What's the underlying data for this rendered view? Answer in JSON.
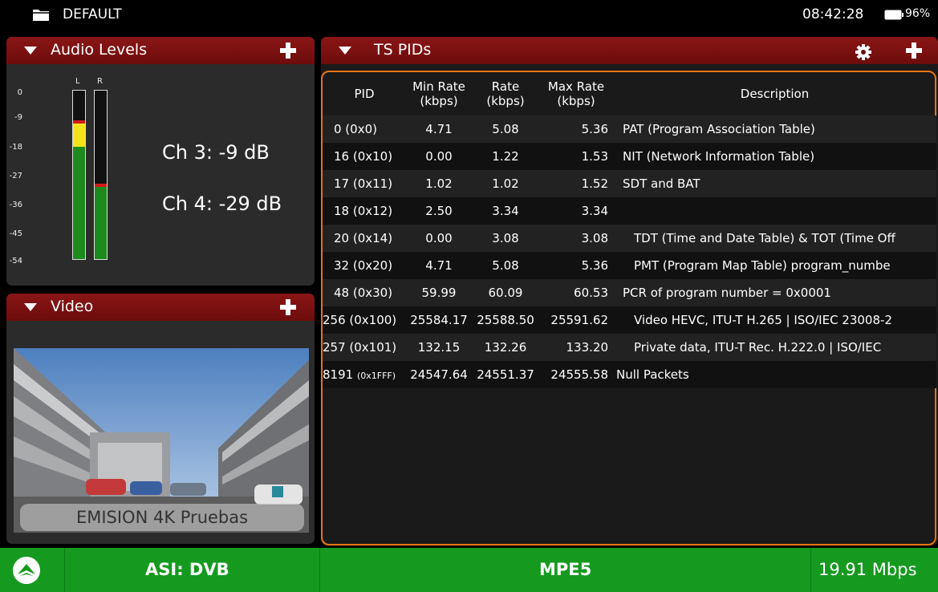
{
  "status_bar": {
    "profile": "DEFAULT",
    "time": "08:42:28",
    "battery": "96%"
  },
  "audio_panel": {
    "title": "Audio Levels",
    "scale": [
      "0",
      "-9",
      "-18",
      "-27",
      "-36",
      "-45",
      "-54"
    ],
    "left_label": "L",
    "right_label": "R",
    "channels": [
      {
        "label": "Ch 3:  -9 dB"
      },
      {
        "label": "Ch 4:  -29 dB"
      }
    ],
    "levels_db": {
      "L": -9,
      "R": -29
    }
  },
  "video_panel": {
    "title": "Video",
    "caption": "EMISION 4K Pruebas"
  },
  "ts_panel": {
    "title": "TS PIDs",
    "columns": {
      "pid": "PID",
      "min_rate_1": "Min Rate",
      "min_rate_2": "(kbps)",
      "rate_1": "Rate",
      "rate_2": "(kbps)",
      "max_rate_1": "Max Rate",
      "max_rate_2": "(kbps)",
      "description": "Description"
    },
    "rows": [
      {
        "pid": "0 (0x0)",
        "min": "4.71",
        "rate": "5.08",
        "max": "5.36",
        "desc": "PAT (Program Association Table)"
      },
      {
        "pid": "16 (0x10)",
        "min": "0.00",
        "rate": "1.22",
        "max": "1.53",
        "desc": "NIT (Network Information Table)"
      },
      {
        "pid": "17 (0x11)",
        "min": "1.02",
        "rate": "1.02",
        "max": "1.52",
        "desc": "SDT and BAT"
      },
      {
        "pid": "18 (0x12)",
        "min": "2.50",
        "rate": "3.34",
        "max": "3.34",
        "desc": ""
      },
      {
        "pid": "20 (0x14)",
        "min": "0.00",
        "rate": "3.08",
        "max": "3.08",
        "desc": "TDT (Time and Date Table) & TOT (Time Off"
      },
      {
        "pid": "32 (0x20)",
        "min": "4.71",
        "rate": "5.08",
        "max": "5.36",
        "desc": "PMT (Program Map Table) program_numbe"
      },
      {
        "pid": "48 (0x30)",
        "min": "59.99",
        "rate": "60.09",
        "max": "60.53",
        "desc": "PCR of program number = 0x0001"
      },
      {
        "pid": "256 (0x100)",
        "min": "25584.17",
        "rate": "25588.50",
        "max": "25591.62",
        "desc": "Video HEVC, ITU-T H.265 | ISO/IEC 23008-2"
      },
      {
        "pid": "257 (0x101)",
        "min": "132.15",
        "rate": "132.26",
        "max": "133.20",
        "desc": "Private data, ITU-T Rec. H.222.0 | ISO/IEC"
      },
      {
        "pid_num": "8191",
        "pid_hex": "(0x1FFF)",
        "min": "24547.64",
        "rate": "24551.37",
        "max": "24555.58",
        "desc": "Null Packets"
      }
    ]
  },
  "bottom_bar": {
    "input": "ASI: DVB",
    "mode": "MPE5",
    "bitrate": "19.91 Mbps"
  },
  "colors": {
    "header_red": "#7a1010",
    "accent_orange": "#e77413",
    "bottom_green": "#159a1f"
  }
}
